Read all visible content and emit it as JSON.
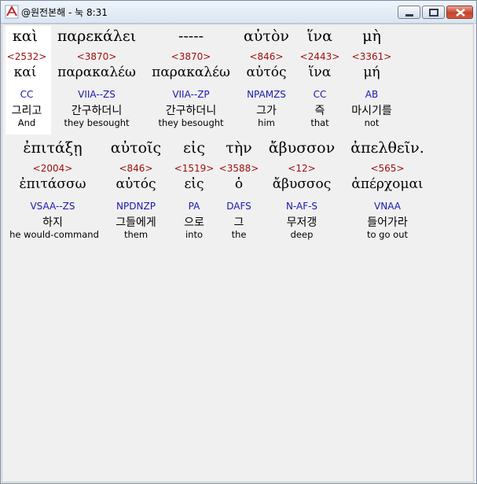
{
  "window": {
    "title": "@원전본해 - 눅 8:31"
  },
  "verse_rows": [
    {
      "words": [
        {
          "greek": "καὶ",
          "strong": "<2532>",
          "lemma": "καί",
          "morph": "CC",
          "korean": "그리고",
          "english": "And"
        },
        {
          "greek": "παρεκάλει",
          "strong": "<3870>",
          "lemma": "παρακαλέω",
          "morph": "VIIA--ZS",
          "korean": "간구하더니",
          "english": "they besought"
        },
        {
          "greek": "-----",
          "strong": "<3870>",
          "lemma": "παρακαλέω",
          "morph": "VIIA--ZP",
          "korean": "간구하더니",
          "english": "they besought"
        },
        {
          "greek": "αὐτὸν",
          "strong": "<846>",
          "lemma": "αὐτός",
          "morph": "NPAMZS",
          "korean": "그가",
          "english": "him"
        },
        {
          "greek": "ἵνα",
          "strong": "<2443>",
          "lemma": "ἵνα",
          "morph": "CC",
          "korean": "즉",
          "english": "that"
        },
        {
          "greek": "μὴ",
          "strong": "<3361>",
          "lemma": "μή",
          "morph": "AB",
          "korean": "마시기를",
          "english": "not"
        }
      ]
    },
    {
      "words": [
        {
          "greek": "ἐπιτάξῃ",
          "strong": "<2004>",
          "lemma": "ἐπιτάσσω",
          "morph": "VSAA--ZS",
          "korean": "하지",
          "english": "he would-command"
        },
        {
          "greek": "αὐτοῖς",
          "strong": "<846>",
          "lemma": "αὐτός",
          "morph": "NPDNZP",
          "korean": "그들에게",
          "english": "them"
        },
        {
          "greek": "εἰς",
          "strong": "<1519>",
          "lemma": "εἰς",
          "morph": "PA",
          "korean": "으로",
          "english": "into"
        },
        {
          "greek": "τὴν",
          "strong": "<3588>",
          "lemma": "ὁ",
          "morph": "DAFS",
          "korean": "그",
          "english": "the"
        },
        {
          "greek": "ἄβυσσον",
          "strong": "<12>",
          "lemma": "ἄβυσσος",
          "morph": "N-AF-S",
          "korean": "무저갱",
          "english": "deep"
        },
        {
          "greek": "ἀπελθεῖν.",
          "strong": "<565>",
          "lemma": "ἀπέρχομαι",
          "morph": "VNAA",
          "korean": "들어가라",
          "english": "to go out"
        }
      ]
    }
  ]
}
